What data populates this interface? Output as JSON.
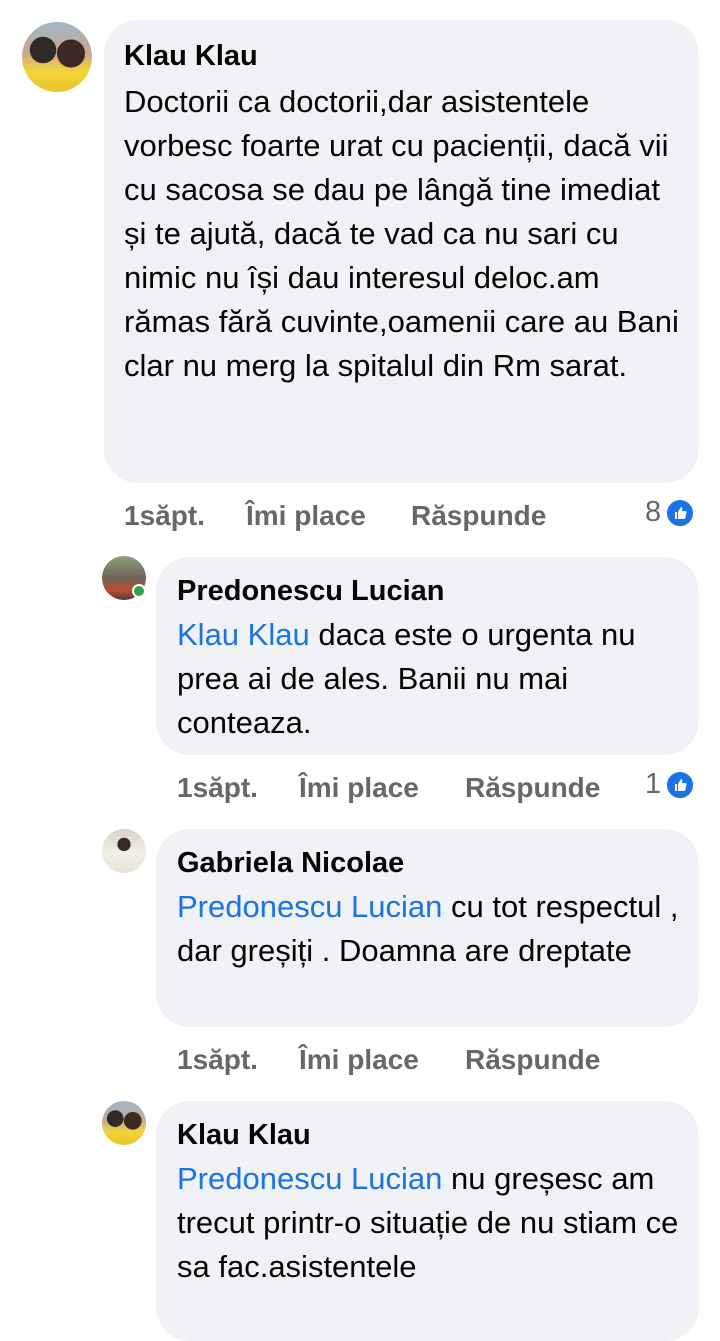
{
  "comments": [
    {
      "author": "Klau Klau",
      "mention": "",
      "text": "Doctorii ca doctorii,dar asistentele vorbesc foarte urat cu pacienții, dacă vii cu sacosa se dau pe lângă tine imediat  și te ajută, dacă te vad ca nu sari cu nimic nu își dau interesul deloc.am rămas fără cuvinte,oamenii care au Bani clar nu merg la spitalul din Rm sarat.",
      "time": "1săpt.",
      "like_label": "Îmi place",
      "reply_label": "Răspunde",
      "reaction_count": "8"
    },
    {
      "author": "Predonescu Lucian",
      "mention": "Klau Klau",
      "text": "daca este o urgenta nu prea ai de ales. Banii nu mai conteaza.",
      "time": "1săpt.",
      "like_label": "Îmi place",
      "reply_label": "Răspunde",
      "reaction_count": "1"
    },
    {
      "author": "Gabriela Nicolae",
      "mention": "Predonescu Lucian",
      "text": "cu tot respectul , dar greșiți . Doamna are dreptate",
      "time": "1săpt.",
      "like_label": "Îmi place",
      "reply_label": "Răspunde"
    },
    {
      "author": "Klau Klau",
      "mention": "Predonescu Lucian",
      "text": "nu greșesc am trecut printr-o situație de nu stiam ce sa fac.asistentele"
    }
  ],
  "colors": {
    "bubble": "#f0f2f5",
    "mention": "#1b74e4",
    "meta": "#65676b",
    "like_icon": "#1b74e4",
    "online": "#31a24c"
  },
  "icons": {
    "like": "thumbs-up-icon"
  }
}
